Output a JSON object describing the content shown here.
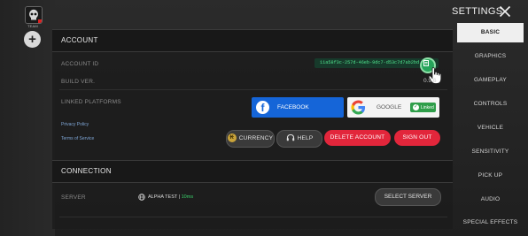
{
  "rail": {
    "team_label": "TEAM",
    "add_symbol": "+"
  },
  "header": {
    "title": "SETTINGS",
    "close_icon": "close-icon"
  },
  "menu": {
    "items": [
      {
        "label": "BASIC",
        "active": true
      },
      {
        "label": "GRAPHICS"
      },
      {
        "label": "GAMEPLAY"
      },
      {
        "label": "CONTROLS"
      },
      {
        "label": "VEHICLE"
      },
      {
        "label": "SENSITIVITY"
      },
      {
        "label": "PICK UP"
      },
      {
        "label": "AUDIO"
      },
      {
        "label": "SPECIAL EFFECTS"
      }
    ]
  },
  "account": {
    "section_title": "ACCOUNT",
    "account_id_label": "ACCOUNT ID",
    "account_id_value": "11a58f3c-257d-46eb-9dc7-d53c7d7ab2bd",
    "build_ver_label": "BUILD VER.",
    "build_ver_value": "0.9.6",
    "linked_platforms_label": "LINKED PLATFORMS",
    "privacy_policy": "Privacy Policy",
    "terms_of_service": "Terms of Service",
    "facebook_label": "FACEBOOK",
    "google_label": "GOOGLE",
    "google_status": "Linked",
    "buttons": {
      "currency": "CURRENCY",
      "help": "HELP",
      "delete_account": "DELETE ACCOUNT",
      "sign_out": "SIGN OUT"
    }
  },
  "connection": {
    "section_title": "CONNECTION",
    "server_label": "SERVER",
    "server_name": "ALPHA TEST",
    "server_sep": " | ",
    "server_ping": "10ms",
    "select_server": "SELECT SERVER"
  },
  "colors": {
    "accent_red": "#e2263b",
    "facebook_blue": "#1565d8",
    "linked_green": "#2f9e4a",
    "id_text_green": "#4fe38d"
  }
}
